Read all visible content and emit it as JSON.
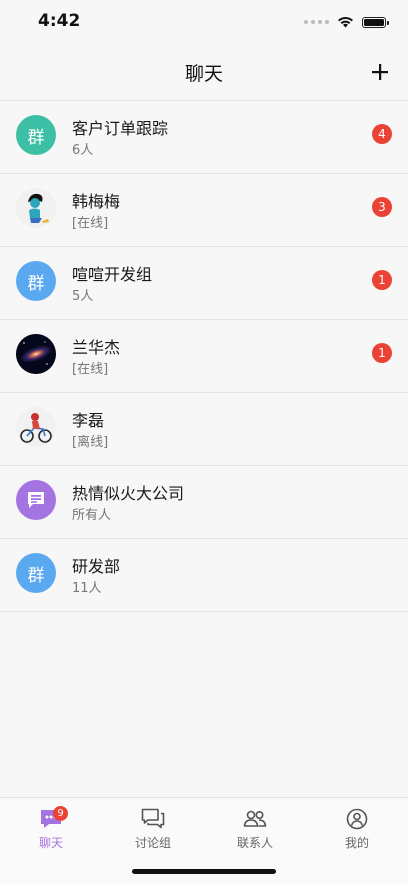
{
  "status_bar": {
    "time": "4:42"
  },
  "header": {
    "title": "聊天",
    "add_icon": "plus-icon"
  },
  "colors": {
    "group_teal": "#3cbfa4",
    "group_blue": "#5aa8f0",
    "purple": "#a374e2",
    "badge_red": "#ea4335"
  },
  "chats": [
    {
      "name": "客户订单跟踪",
      "sub": "6人",
      "avatar_text": "群",
      "badge": "4"
    },
    {
      "name": "韩梅梅",
      "sub": "[在线]",
      "badge": "3"
    },
    {
      "name": "喧喧开发组",
      "sub": "5人",
      "avatar_text": "群",
      "badge": "1"
    },
    {
      "name": "兰华杰",
      "sub": "[在线]",
      "badge": "1"
    },
    {
      "name": "李磊",
      "sub": "[离线]"
    },
    {
      "name": "热情似火大公司",
      "sub": "所有人"
    },
    {
      "name": "研发部",
      "sub": "11人",
      "avatar_text": "群"
    }
  ],
  "tabs": [
    {
      "label": "聊天",
      "icon": "chat-bubble-icon",
      "badge": "9",
      "active": true
    },
    {
      "label": "讨论组",
      "icon": "discussion-icon"
    },
    {
      "label": "联系人",
      "icon": "contacts-icon"
    },
    {
      "label": "我的",
      "icon": "profile-icon"
    }
  ]
}
